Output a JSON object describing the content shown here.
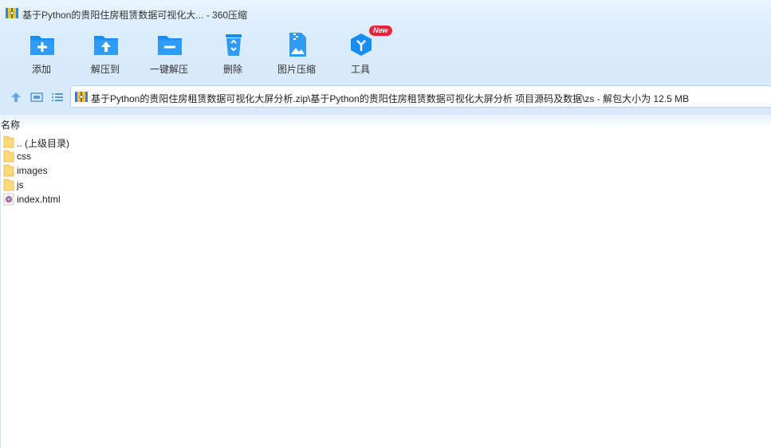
{
  "window": {
    "title": "基于Python的贵阳住房租赁数据可视化大... - 360压缩"
  },
  "toolbar": {
    "add_label": "添加",
    "extract_to_label": "解压到",
    "one_click_extract_label": "一键解压",
    "delete_label": "删除",
    "image_compress_label": "图片压缩",
    "tools_label": "工具",
    "tools_badge": "New"
  },
  "address": {
    "path": "基于Python的贵阳住房租赁数据可视化大屏分析.zip\\基于Python的贵阳住房租赁数据可视化大屏分析 项目源码及数据\\zs - 解包大小为 12.5 MB"
  },
  "file_list": {
    "column_name": "名称",
    "items": [
      {
        "name": ".. (上级目录)",
        "icon": "folder-icon"
      },
      {
        "name": "css",
        "icon": "folder-icon"
      },
      {
        "name": "images",
        "icon": "folder-icon"
      },
      {
        "name": "js",
        "icon": "folder-icon"
      },
      {
        "name": "index.html",
        "icon": "html-file-icon"
      }
    ]
  },
  "colors": {
    "accent_blue": "#1a8cf0",
    "toolbar_bg": "#d6eafb",
    "badge_red": "#f0213a",
    "folder_yellow": "#fcd97b"
  }
}
